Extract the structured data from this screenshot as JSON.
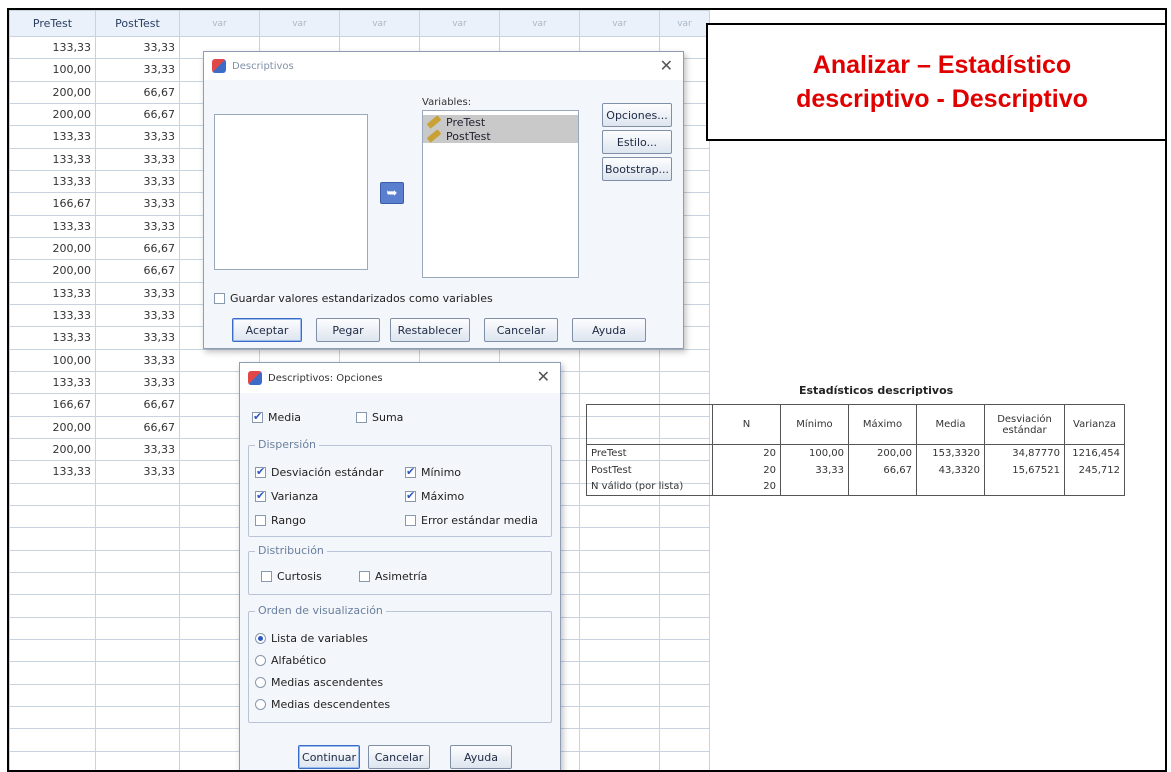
{
  "sheet": {
    "columns": [
      "PreTest",
      "PostTest",
      "var",
      "var",
      "var",
      "var",
      "var",
      "var",
      "var"
    ],
    "rows": [
      [
        "133,33",
        "33,33"
      ],
      [
        "100,00",
        "33,33"
      ],
      [
        "200,00",
        "66,67"
      ],
      [
        "200,00",
        "66,67"
      ],
      [
        "133,33",
        "33,33"
      ],
      [
        "133,33",
        "33,33"
      ],
      [
        "133,33",
        "33,33"
      ],
      [
        "166,67",
        "33,33"
      ],
      [
        "133,33",
        "33,33"
      ],
      [
        "200,00",
        "66,67"
      ],
      [
        "200,00",
        "66,67"
      ],
      [
        "133,33",
        "33,33"
      ],
      [
        "133,33",
        "33,33"
      ],
      [
        "133,33",
        "33,33"
      ],
      [
        "100,00",
        "33,33"
      ],
      [
        "133,33",
        "33,33"
      ],
      [
        "166,67",
        "66,67"
      ],
      [
        "200,00",
        "66,67"
      ],
      [
        "200,00",
        "33,33"
      ],
      [
        "133,33",
        "33,33"
      ],
      [
        "",
        ""
      ],
      [
        "",
        ""
      ],
      [
        "",
        ""
      ],
      [
        "",
        ""
      ],
      [
        "",
        ""
      ],
      [
        "",
        ""
      ],
      [
        "",
        ""
      ],
      [
        "",
        ""
      ],
      [
        "",
        ""
      ],
      [
        "",
        ""
      ],
      [
        "",
        ""
      ],
      [
        "",
        ""
      ],
      [
        "",
        ""
      ]
    ]
  },
  "annotation": {
    "text": "Analizar – Estadístico\ndescriptivo - Descriptivo",
    "color": "#e00000"
  },
  "descriptivos": {
    "title": "Descriptivos",
    "variables_label": "Variables:",
    "variables": [
      "PreTest",
      "PostTest"
    ],
    "side_buttons": [
      "Opciones...",
      "Estilo...",
      "Bootstrap..."
    ],
    "save_label": "Guardar valores estandarizados como variables",
    "footer_buttons": [
      "Aceptar",
      "Pegar",
      "Restablecer",
      "Cancelar",
      "Ayuda"
    ]
  },
  "opciones": {
    "title": "Descriptivos: Opciones",
    "media": "Media",
    "suma": "Suma",
    "dispersion_label": "Dispersión",
    "dispersion": {
      "desv": "Desviación estándar",
      "minimo": "Mínimo",
      "varianza": "Varianza",
      "maximo": "Máximo",
      "rango": "Rango",
      "error": "Error estándar media"
    },
    "distribucion_label": "Distribución",
    "distribucion": {
      "curtosis": "Curtosis",
      "asimetria": "Asimetría"
    },
    "orden_label": "Orden de visualización",
    "orden": [
      "Lista de variables",
      "Alfabético",
      "Medias ascendentes",
      "Medias descendentes"
    ],
    "buttons": [
      "Continuar",
      "Cancelar",
      "Ayuda"
    ]
  },
  "stats": {
    "title": "Estadísticos descriptivos",
    "headers": [
      "",
      "N",
      "Mínimo",
      "Máximo",
      "Media",
      "Desviación estándar",
      "Varianza"
    ],
    "rows": [
      [
        "PreTest",
        "20",
        "100,00",
        "200,00",
        "153,3320",
        "34,87770",
        "1216,454"
      ],
      [
        "PostTest",
        "20",
        "33,33",
        "66,67",
        "43,3320",
        "15,67521",
        "245,712"
      ],
      [
        "N válido (por lista)",
        "20",
        "",
        "",
        "",
        "",
        ""
      ]
    ]
  }
}
